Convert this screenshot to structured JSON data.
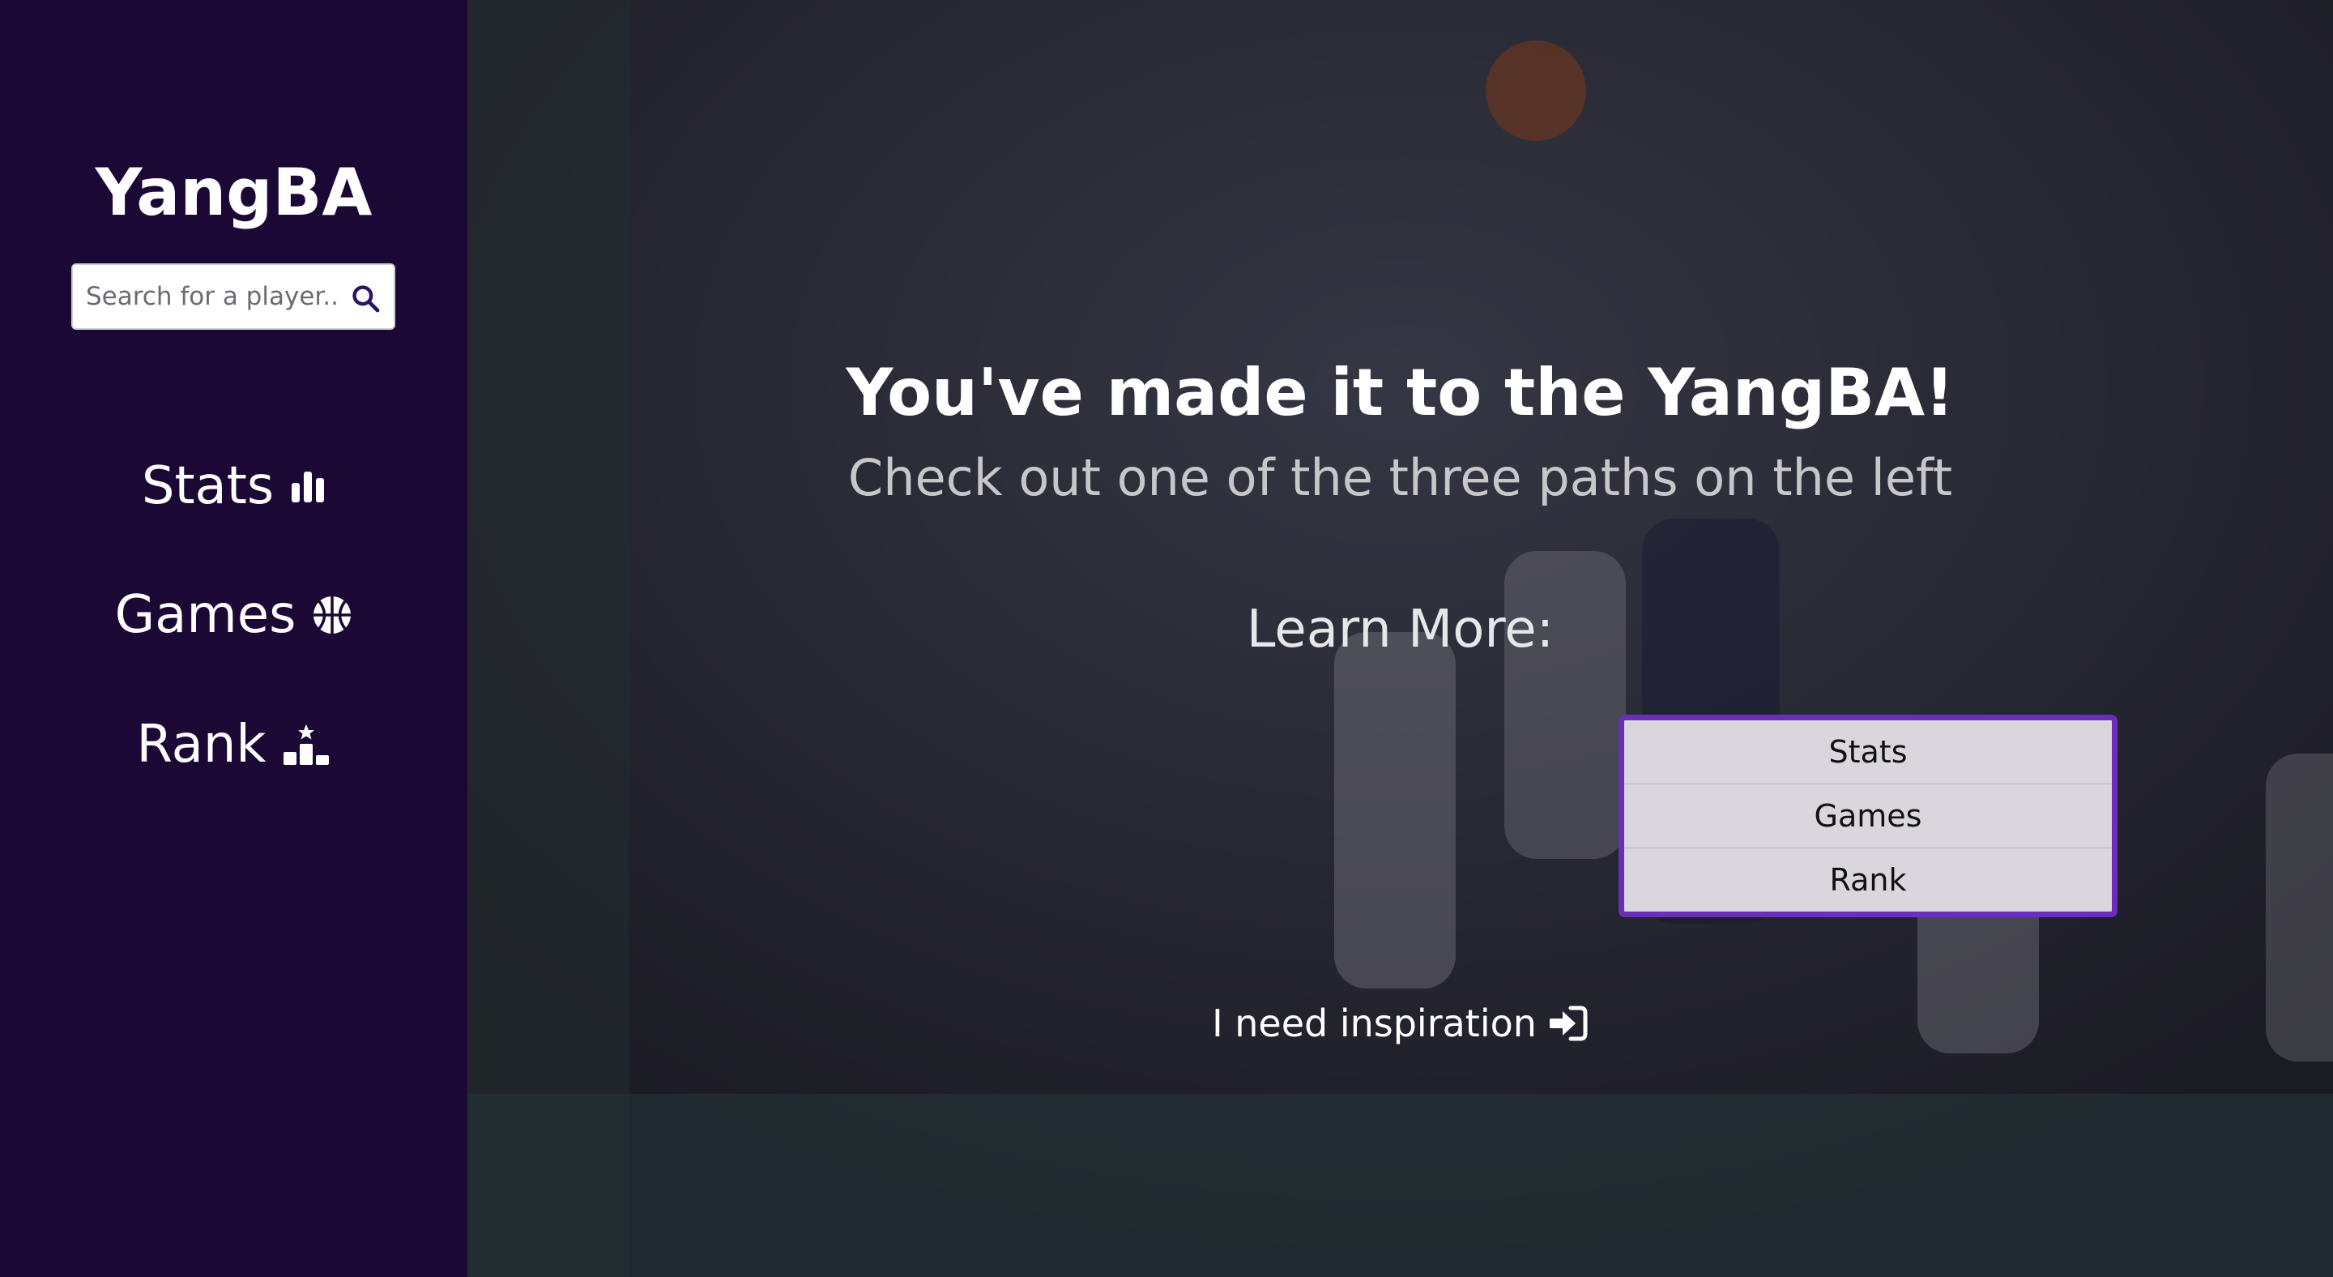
{
  "sidebar": {
    "brand": "YangBA",
    "search": {
      "placeholder": "Search for a player...",
      "value": "",
      "icon": "search-icon"
    },
    "nav": [
      {
        "label": "Stats",
        "icon": "bar-chart-icon"
      },
      {
        "label": "Games",
        "icon": "basketball-icon"
      },
      {
        "label": "Rank",
        "icon": "podium-icon"
      }
    ]
  },
  "main": {
    "headline": "You've made it to the YangBA!",
    "subline": "Check out one of the three paths on the left",
    "learn_more_label": "Learn More:",
    "learn_more_options": [
      "Stats",
      "Games",
      "Rank"
    ],
    "inspiration_label": "I need inspiration",
    "inspiration_icon": "sign-in-icon"
  },
  "colors": {
    "sidebar_bg": "#1b0835",
    "accent": "#6a2eb8",
    "text_primary": "#ffffff",
    "text_secondary": "#c7c7ca"
  }
}
